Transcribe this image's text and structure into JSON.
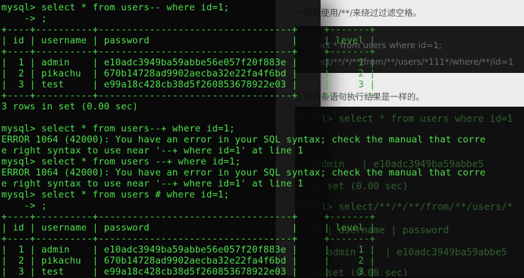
{
  "background_page": {
    "intro": "一般是使用/**/来绕过过滤空格。",
    "code_lines": [
      "select * from users where id=1;",
      "select/**/*/**/from/**/users/*111*/where/**/id=1"
    ],
    "conclusion": "上面两条语句执行结果是一样的。",
    "terminal_lines": [
      "mysql> select * from users where id=1",
      " | admin   | e10adc3949ba59abbe5",
      "  in set (0.00 sec)",
      "mysql> select/**/*/**/from/**/users/*",
      "  id | username | password",
      "   | admin     | e10adc3949ba59abbe5",
      "  in set (0.00 sec)"
    ]
  },
  "terminal": {
    "lines": [
      "mysql> select * from users-- where id=1;",
      "    -> ;",
      "+----+----------+----------------------------------+",
      "| id | username | password                         |",
      "+----+----------+----------------------------------+",
      "|  1 | admin    | e10adc3949ba59abbe56e057f20f883e |",
      "|  2 | pikachu  | 670b14728ad9902aecba32e22fa4f6bd |",
      "|  3 | test     | e99a18c428cb38d5f260853678922e03 |",
      "+----+----------+----------------------------------+",
      "3 rows in set (0.00 sec)",
      "",
      "mysql> select * from users--+ where id=1;",
      "ERROR 1064 (42000): You have an error in your SQL syntax; check the manual that corre",
      "e right syntax to use near '--+ where id=1' at line 1",
      "mysql> select * from users --+ where id=1;",
      "ERROR 1064 (42000): You have an error in your SQL syntax; check the manual that corre",
      "e right syntax to use near '--+ where id=1' at line 1",
      "mysql> select * from users # where id=1;",
      "    -> ;",
      "+----+----------+----------------------------------+",
      "| id | username | password                         |",
      "+----+----------+----------------------------------+",
      "|  1 | admin    | e10adc3949ba59abbe56e057f20f883e |",
      "|  2 | pikachu  | 670b14728ad9902aecba32e22fa4f6bd |",
      "|  3 | test     | e99a18c428cb38d5f260853678922e03 |"
    ],
    "level_column": {
      "border": "+-------+",
      "header": "| level |",
      "rows": [
        "|     1 |",
        "|     2 |",
        "|     3 |"
      ]
    }
  }
}
